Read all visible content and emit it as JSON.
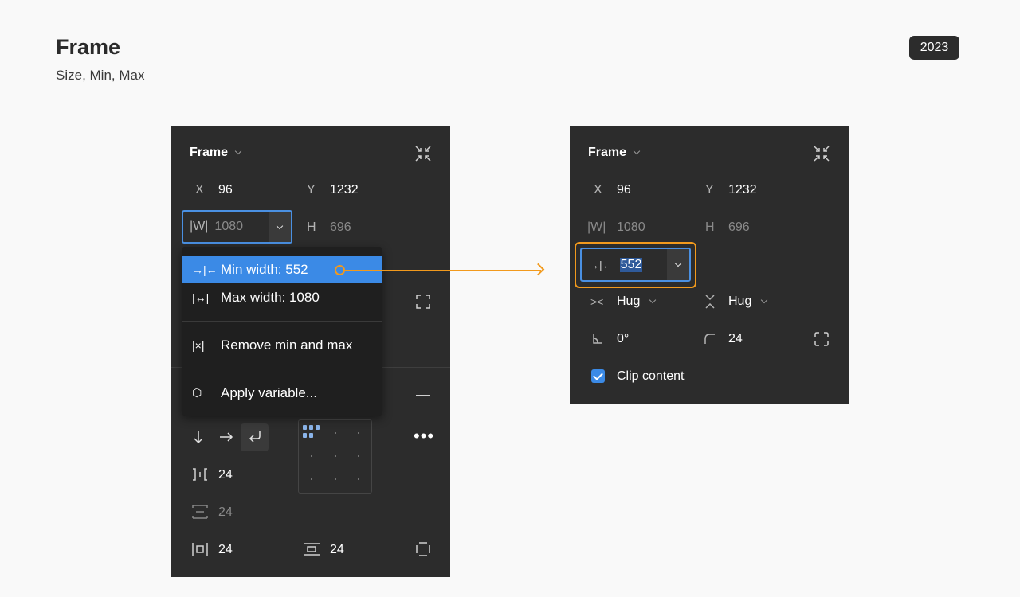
{
  "header": {
    "title": "Frame",
    "subtitle": "Size, Min, Max",
    "year": "2023"
  },
  "left_panel": {
    "title": "Frame",
    "x_label": "X",
    "x_value": "96",
    "y_label": "Y",
    "y_value": "1232",
    "w_label": "|W|",
    "w_value": "1080",
    "h_label": "H",
    "h_value": "696",
    "spacing_value": "24",
    "padding_v_value": "24",
    "padding_h_value": "24",
    "padding_b_value": "24"
  },
  "menu": {
    "items": [
      {
        "icon": "→|←",
        "label": "Min width: 552"
      },
      {
        "icon": "|↔|",
        "label": "Max width: 1080"
      },
      {
        "icon": "|×|",
        "label": "Remove min and max"
      },
      {
        "icon": "⬡",
        "label": "Apply variable..."
      }
    ]
  },
  "right_panel": {
    "title": "Frame",
    "x_label": "X",
    "x_value": "96",
    "y_label": "Y",
    "y_value": "1232",
    "w_label": "|W|",
    "w_value": "1080",
    "h_label": "H",
    "h_value": "696",
    "min_width_value": "552",
    "width_mode": "Hug",
    "height_mode": "Hug",
    "rotation": "0°",
    "corner_radius": "24",
    "clip_label": "Clip content"
  },
  "colors": {
    "accent": "#3b8ae6",
    "highlight": "#f29a1d",
    "panel": "#2c2c2c"
  }
}
